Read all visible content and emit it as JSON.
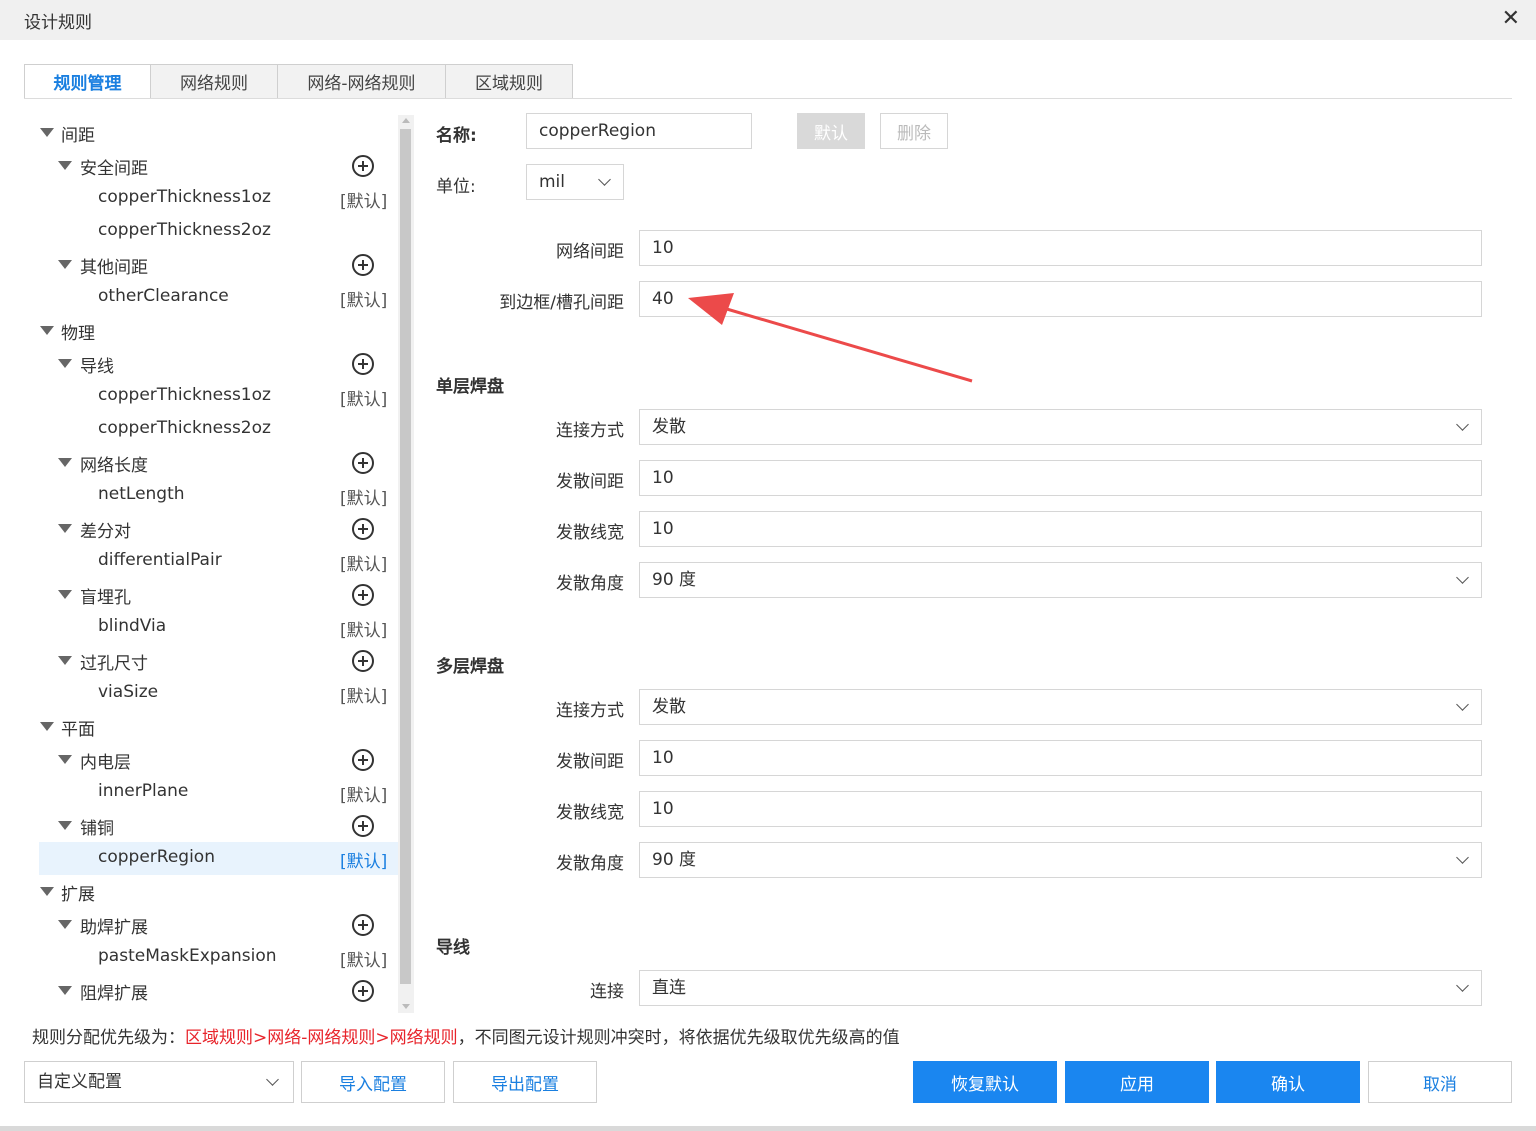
{
  "window": {
    "title": "设计规则",
    "close_symbol": "✕"
  },
  "tabs": [
    {
      "label": "规则管理",
      "active": true
    },
    {
      "label": "网络规则",
      "active": false
    },
    {
      "label": "网络-网络规则",
      "active": false
    },
    {
      "label": "区域规则",
      "active": false
    }
  ],
  "tree": {
    "default_tag": "[默认]",
    "items": [
      {
        "level": 0,
        "label": "间距"
      },
      {
        "level": 1,
        "label": "安全间距",
        "add": true
      },
      {
        "level": 2,
        "label": "copperThickness1oz",
        "default": true
      },
      {
        "level": 2,
        "label": "copperThickness2oz"
      },
      {
        "level": 1,
        "label": "其他间距",
        "add": true
      },
      {
        "level": 2,
        "label": "otherClearance",
        "default": true
      },
      {
        "level": 0,
        "label": "物理"
      },
      {
        "level": 1,
        "label": "导线",
        "add": true
      },
      {
        "level": 2,
        "label": "copperThickness1oz",
        "default": true
      },
      {
        "level": 2,
        "label": "copperThickness2oz"
      },
      {
        "level": 1,
        "label": "网络长度",
        "add": true
      },
      {
        "level": 2,
        "label": "netLength",
        "default": true
      },
      {
        "level": 1,
        "label": "差分对",
        "add": true
      },
      {
        "level": 2,
        "label": "differentialPair",
        "default": true
      },
      {
        "level": 1,
        "label": "盲埋孔",
        "add": true
      },
      {
        "level": 2,
        "label": "blindVia",
        "default": true
      },
      {
        "level": 1,
        "label": "过孔尺寸",
        "add": true
      },
      {
        "level": 2,
        "label": "viaSize",
        "default": true
      },
      {
        "level": 0,
        "label": "平面"
      },
      {
        "level": 1,
        "label": "内电层",
        "add": true
      },
      {
        "level": 2,
        "label": "innerPlane",
        "default": true
      },
      {
        "level": 1,
        "label": "铺铜",
        "add": true
      },
      {
        "level": 2,
        "label": "copperRegion",
        "default": true,
        "selected": true
      },
      {
        "level": 0,
        "label": "扩展"
      },
      {
        "level": 1,
        "label": "助焊扩展",
        "add": true
      },
      {
        "level": 2,
        "label": "pasteMaskExpansion",
        "default": true
      },
      {
        "level": 1,
        "label": "阻焊扩展",
        "add": true
      }
    ]
  },
  "form": {
    "name_label": "名称:",
    "name_value": "copperRegion",
    "default_button": "默认",
    "delete_button": "删除",
    "unit_label": "单位:",
    "unit_value": "mil",
    "net_clearance_label": "网络间距",
    "net_clearance_value": "10",
    "board_clearance_label": "到边框/槽孔间距",
    "board_clearance_value": "40",
    "single_pad": {
      "heading": "单层焊盘",
      "connect_label": "连接方式",
      "connect_value": "发散",
      "spoke_gap_label": "发散间距",
      "spoke_gap_value": "10",
      "spoke_width_label": "发散线宽",
      "spoke_width_value": "10",
      "spoke_angle_label": "发散角度",
      "spoke_angle_value": "90 度"
    },
    "multi_pad": {
      "heading": "多层焊盘",
      "connect_label": "连接方式",
      "connect_value": "发散",
      "spoke_gap_label": "发散间距",
      "spoke_gap_value": "10",
      "spoke_width_label": "发散线宽",
      "spoke_width_value": "10",
      "spoke_angle_label": "发散角度",
      "spoke_angle_value": "90 度"
    },
    "track": {
      "heading": "导线",
      "connect_label": "连接",
      "connect_value": "直连"
    }
  },
  "note": {
    "prefix": "规则分配优先级为：",
    "priority": "区域规则>网络-网络规则>网络规则",
    "suffix": "，不同图元设计规则冲突时，将依据优先级取优先级高的值"
  },
  "footer": {
    "config_value": "自定义配置",
    "import_button": "导入配置",
    "export_button": "导出配置",
    "restore_button": "恢复默认",
    "apply_button": "应用",
    "confirm_button": "确认",
    "cancel_button": "取消"
  },
  "colors": {
    "accent": "#1a86f0",
    "tab_active_text": "#1a7fe0",
    "priority_text": "#e8242b",
    "annotation_arrow": "#ec4a4a",
    "selected_row_bg": "#e8f3fd"
  }
}
